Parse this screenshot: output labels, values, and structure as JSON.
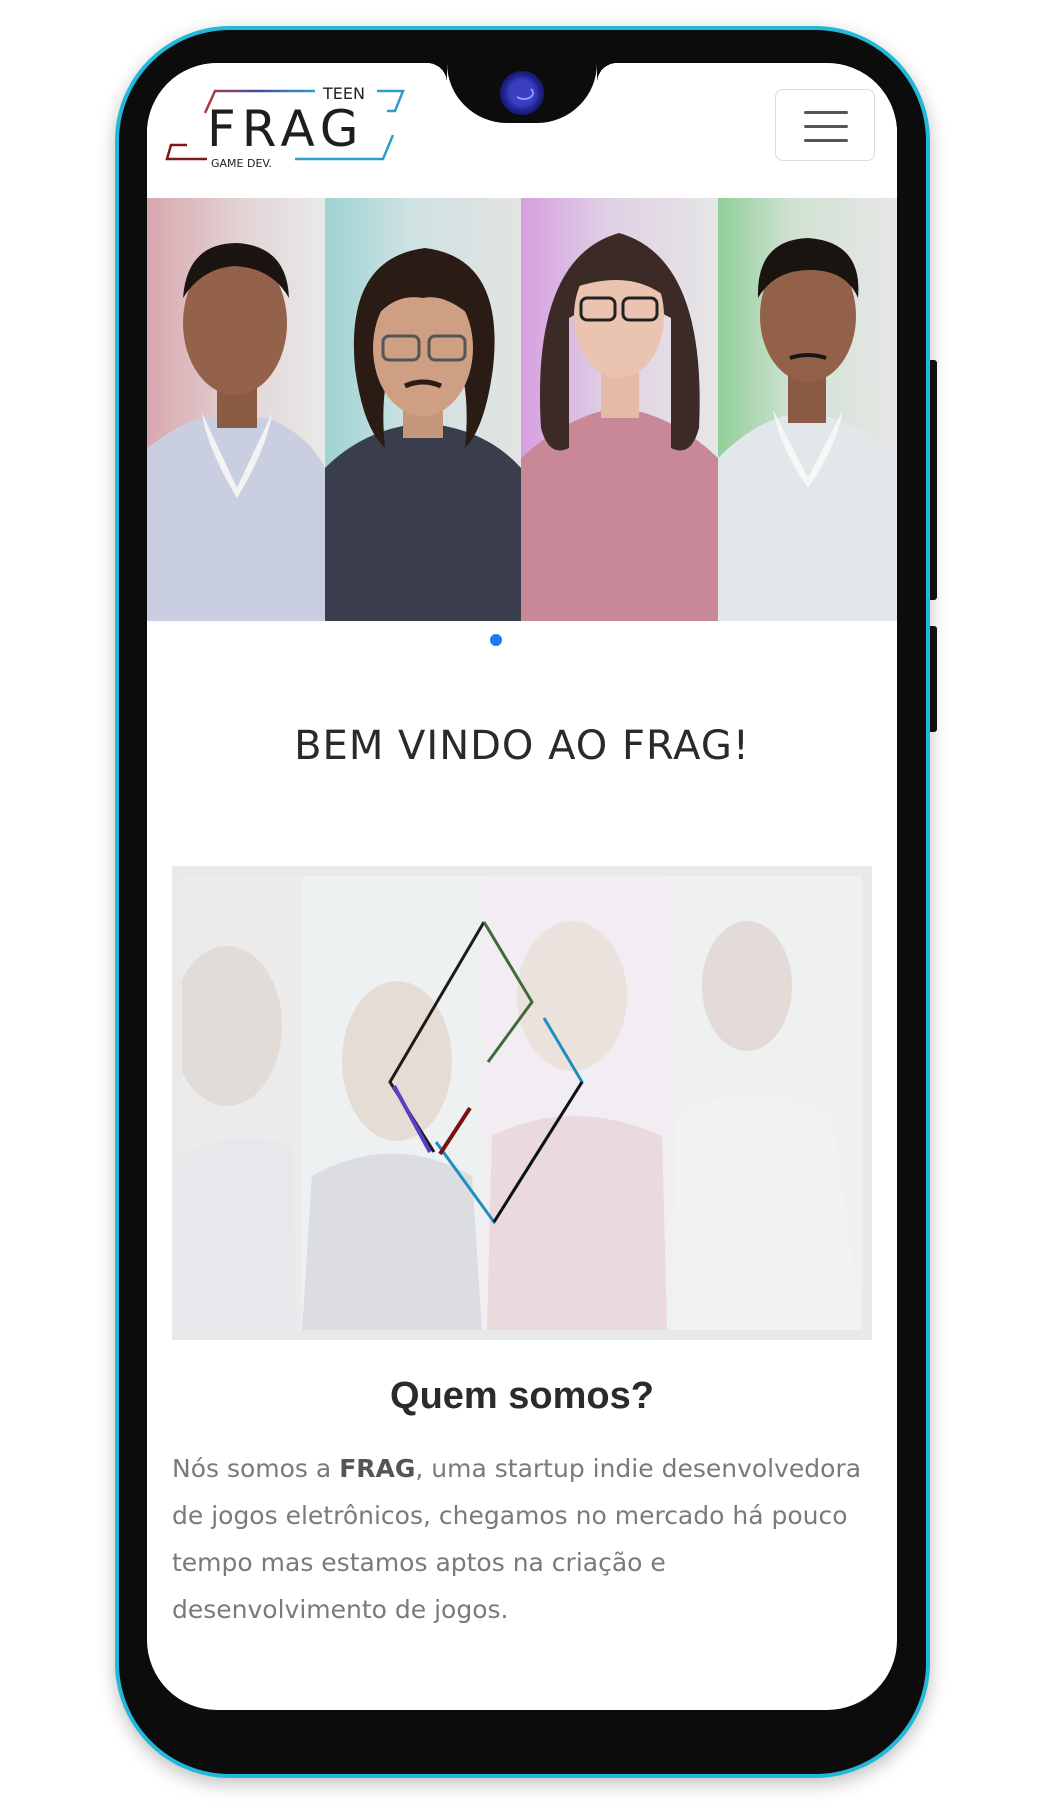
{
  "header": {
    "logo": {
      "teen": "TEEN",
      "brand": "FRAG",
      "sub": "GAME DEV."
    },
    "menu_icon": "hamburger-menu-icon"
  },
  "hero": {
    "slides": 4,
    "active_slide": 1,
    "panel_colors": [
      "#d9a7ae",
      "#9fd3d4",
      "#d69fe0",
      "#8fcf98"
    ],
    "indicator_color": "#1a7cf5"
  },
  "welcome": {
    "title": "BEM VINDO AO FRAG!"
  },
  "about": {
    "logo_colors": [
      "#1b1b1b",
      "#3f6b3a",
      "#1d8fbf",
      "#5a3fc0",
      "#7a1010"
    ],
    "title": "Quem somos?",
    "text_before": "Nós somos a ",
    "text_bold": "FRAG",
    "text_after": ", uma startup indie desenvolvedora de jogos eletrônicos, chegamos no mercado há pouco tempo mas estamos aptos na criação e desenvolvimento de jogos."
  },
  "phone": {
    "frame_color": "#23b8d8"
  }
}
